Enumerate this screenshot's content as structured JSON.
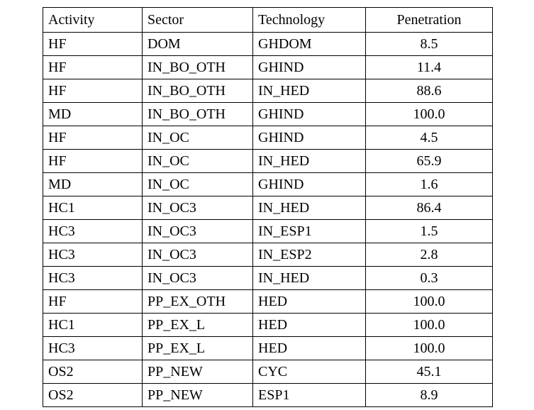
{
  "table": {
    "columns": [
      {
        "key": "activity",
        "label": "Activity",
        "align": "left"
      },
      {
        "key": "sector",
        "label": "Sector",
        "align": "left"
      },
      {
        "key": "technology",
        "label": "Technology",
        "align": "left"
      },
      {
        "key": "penetration",
        "label": "Penetration",
        "align": "center"
      }
    ],
    "rows": [
      {
        "activity": "HF",
        "sector": "DOM",
        "technology": "GHDOM",
        "penetration": "8.5"
      },
      {
        "activity": "HF",
        "sector": "IN_BO_OTH",
        "technology": "GHIND",
        "penetration": "11.4"
      },
      {
        "activity": "HF",
        "sector": "IN_BO_OTH",
        "technology": "IN_HED",
        "penetration": "88.6"
      },
      {
        "activity": "MD",
        "sector": "IN_BO_OTH",
        "technology": "GHIND",
        "penetration": "100.0"
      },
      {
        "activity": "HF",
        "sector": "IN_OC",
        "technology": "GHIND",
        "penetration": "4.5"
      },
      {
        "activity": "HF",
        "sector": "IN_OC",
        "technology": "IN_HED",
        "penetration": "65.9"
      },
      {
        "activity": "MD",
        "sector": "IN_OC",
        "technology": "GHIND",
        "penetration": "1.6"
      },
      {
        "activity": "HC1",
        "sector": "IN_OC3",
        "technology": "IN_HED",
        "penetration": "86.4"
      },
      {
        "activity": "HC3",
        "sector": "IN_OC3",
        "technology": "IN_ESP1",
        "penetration": "1.5"
      },
      {
        "activity": "HC3",
        "sector": "IN_OC3",
        "technology": "IN_ESP2",
        "penetration": "2.8"
      },
      {
        "activity": "HC3",
        "sector": "IN_OC3",
        "technology": "IN_HED",
        "penetration": "0.3"
      },
      {
        "activity": "HF",
        "sector": "PP_EX_OTH",
        "technology": "HED",
        "penetration": "100.0"
      },
      {
        "activity": "HC1",
        "sector": "PP_EX_L",
        "technology": "HED",
        "penetration": "100.0"
      },
      {
        "activity": "HC3",
        "sector": "PP_EX_L",
        "technology": "HED",
        "penetration": "100.0"
      },
      {
        "activity": "OS2",
        "sector": "PP_NEW",
        "technology": "CYC",
        "penetration": "45.1"
      },
      {
        "activity": "OS2",
        "sector": "PP_NEW",
        "technology": "ESP1",
        "penetration": "8.9"
      }
    ]
  },
  "colors": {
    "text": "#000000",
    "border": "#000000",
    "background": "#ffffff"
  }
}
